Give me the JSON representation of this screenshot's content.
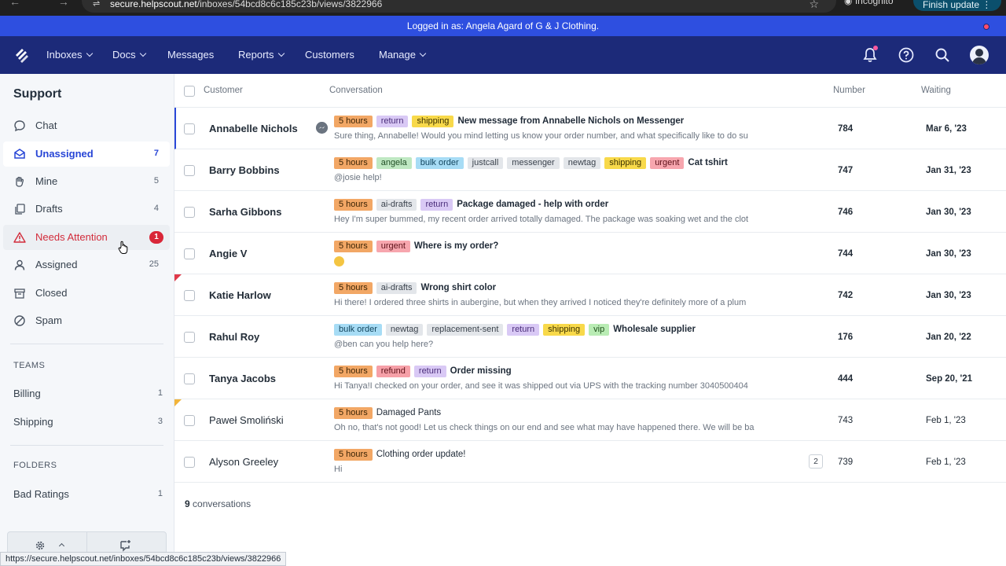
{
  "browser": {
    "url_prefix": "secure.helpscout.net",
    "url_path": "/inboxes/54bcd8c6c185c23b/views/3822966",
    "incognito_label": "Incognito",
    "finish_update_label": "Finish update"
  },
  "banner": {
    "text": "Logged in as: Angela Agard of G & J Clothing."
  },
  "nav": {
    "inboxes": "Inboxes",
    "docs": "Docs",
    "messages": "Messages",
    "reports": "Reports",
    "customers": "Customers",
    "manage": "Manage"
  },
  "sidebar": {
    "title": "Support",
    "items": [
      {
        "label": "Chat",
        "count": ""
      },
      {
        "label": "Unassigned",
        "count": "7"
      },
      {
        "label": "Mine",
        "count": "5"
      },
      {
        "label": "Drafts",
        "count": "4"
      },
      {
        "label": "Needs Attention",
        "count": "1"
      },
      {
        "label": "Assigned",
        "count": "25"
      },
      {
        "label": "Closed",
        "count": ""
      },
      {
        "label": "Spam",
        "count": ""
      }
    ],
    "teams_heading": "TEAMS",
    "teams": [
      {
        "label": "Billing",
        "count": "1"
      },
      {
        "label": "Shipping",
        "count": "3"
      }
    ],
    "folders_heading": "FOLDERS",
    "folders": [
      {
        "label": "Bad Ratings",
        "count": "1"
      }
    ]
  },
  "list": {
    "headers": {
      "customer": "Customer",
      "conversation": "Conversation",
      "number": "Number",
      "waiting": "Waiting"
    },
    "rows": [
      {
        "customer": "Annabelle Nichols",
        "tags": [
          "5 hours",
          "return",
          "shipping"
        ],
        "subject": "New message from Annabelle Nichols on Messenger",
        "preview": "Sure thing, Annabelle! Would you mind letting us know your order number, and what specifically like to do su",
        "number": "784",
        "waiting": "Mar 6, '23"
      },
      {
        "customer": "Barry Bobbins",
        "tags": [
          "5 hours",
          "angela",
          "bulk order",
          "justcall",
          "messenger",
          "newtag",
          "shipping",
          "urgent"
        ],
        "subject": "Cat tshirt",
        "preview": "@josie help!",
        "number": "747",
        "waiting": "Jan 31, '23"
      },
      {
        "customer": "Sarha Gibbons",
        "tags": [
          "5 hours",
          "ai-drafts",
          "return"
        ],
        "subject": "Package damaged - help with order",
        "preview": "Hey I'm super bummed, my recent order arrived totally damaged. The package was soaking wet and the clot",
        "number": "746",
        "waiting": "Jan 30, '23"
      },
      {
        "customer": "Angie V",
        "tags": [
          "5 hours",
          "urgent"
        ],
        "subject": "Where is my order?",
        "preview": "",
        "number": "744",
        "waiting": "Jan 30, '23"
      },
      {
        "customer": "Katie Harlow",
        "tags": [
          "5 hours",
          "ai-drafts"
        ],
        "subject": "Wrong shirt color",
        "preview": "Hi there! I ordered three shirts in aubergine, but when they arrived I noticed they're definitely more of a plum",
        "number": "742",
        "waiting": "Jan 30, '23"
      },
      {
        "customer": "Rahul Roy",
        "tags": [
          "bulk order",
          "newtag",
          "replacement-sent",
          "return",
          "shipping",
          "vip"
        ],
        "subject": "Wholesale supplier",
        "preview": "@ben can you help here?",
        "number": "176",
        "waiting": "Jan 20, '22"
      },
      {
        "customer": "Tanya Jacobs",
        "tags": [
          "5 hours",
          "refund",
          "return"
        ],
        "subject": "Order missing",
        "preview": "Hi Tanya!I checked on your order, and see it was shipped out via UPS with the tracking number 3040500404",
        "number": "444",
        "waiting": "Sep 20, '21"
      },
      {
        "customer": "Paweł Smoliński",
        "tags": [
          "5 hours"
        ],
        "subject": "Damaged Pants",
        "preview": "Oh no, that's not good! Let us check things on our end and see what may have happened there. We will be ba",
        "number": "743",
        "waiting": "Feb 1, '23"
      },
      {
        "customer": "Alyson Greeley",
        "tags": [
          "5 hours"
        ],
        "subject": "Clothing order update!",
        "preview": "Hi",
        "number": "739",
        "waiting": "Feb 1, '23",
        "thread_count": "2"
      }
    ],
    "count_number": "9",
    "count_label": "conversations"
  },
  "status_url": "https://secure.helpscout.net/inboxes/54bcd8c6c185c23b/views/3822966",
  "colors": {
    "nav_bg": "#1c2a79",
    "banner_bg": "#2e4fe0",
    "accent": "#2745d6",
    "alert": "#d92638"
  }
}
